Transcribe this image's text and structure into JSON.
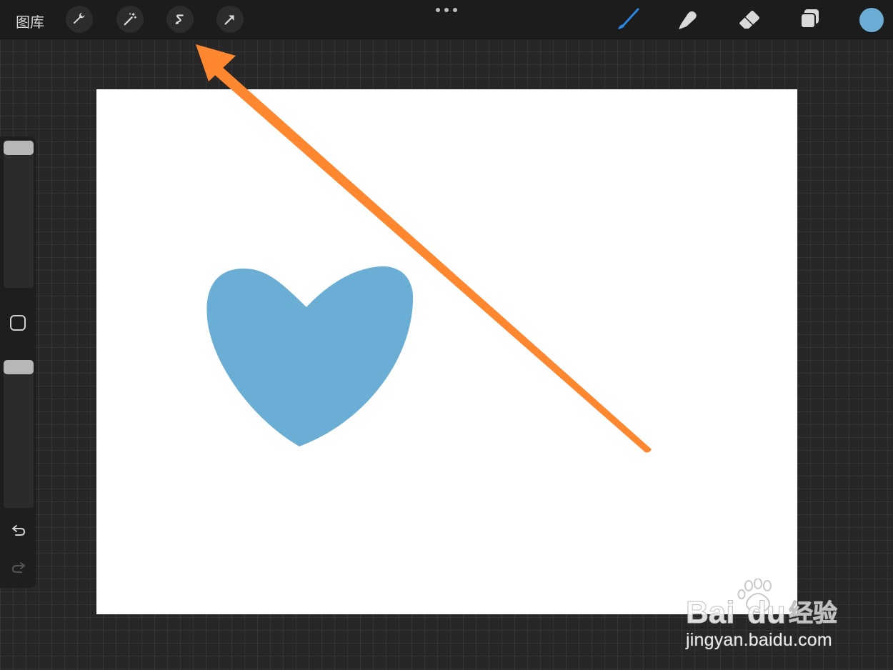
{
  "toolbar": {
    "gallery_label": "图库",
    "left_tools": [
      "wrench-icon",
      "magic-wand-icon",
      "selection-icon",
      "transform-arrow-icon"
    ],
    "right_tools": [
      "brush-icon",
      "smudge-icon",
      "eraser-icon",
      "layers-icon"
    ],
    "current_color": "#6aaed6"
  },
  "canvas": {
    "background": "#ffffff",
    "shape": "heart",
    "shape_color": "#6aaed6"
  },
  "annotation": {
    "arrow_color": "#ff8730"
  },
  "watermark": {
    "logo_text": "Bai du 经验",
    "url": "jingyan.baidu.com"
  }
}
